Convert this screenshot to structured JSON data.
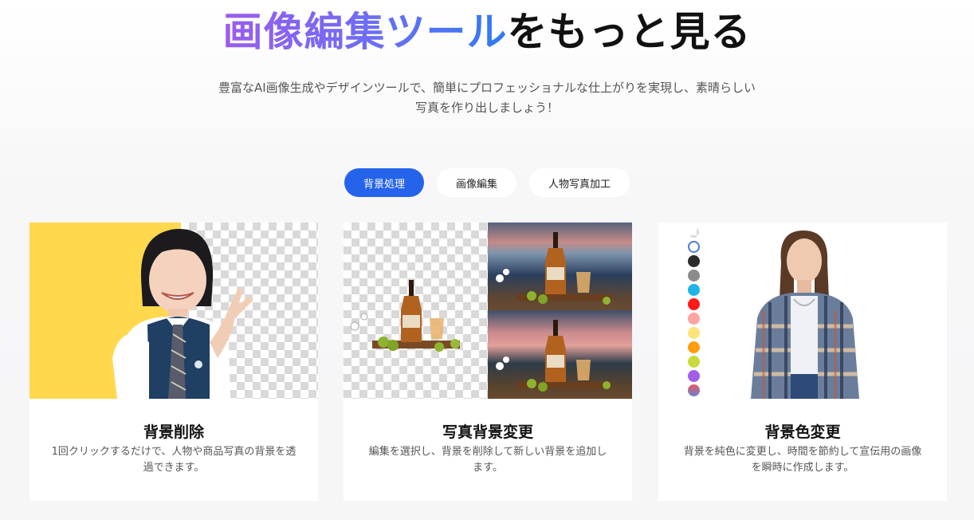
{
  "hero": {
    "title_gradient": "画像編集ツール",
    "title_plain": "をもっと見る",
    "subtitle": "豊富なAI画像生成やデザインツールで、簡単にプロフェッショナルな仕上がりを実現し、素晴らしい写真を作り出しましょう！"
  },
  "tabs": [
    {
      "label": "背景処理",
      "active": true
    },
    {
      "label": "画像編集",
      "active": false
    },
    {
      "label": "人物写真加工",
      "active": false
    }
  ],
  "cards": [
    {
      "title": "背景削除",
      "description": "1回クリックするだけで、人物や商品写真の背景を透過できます。"
    },
    {
      "title": "写真背景変更",
      "description": "編集を選択し、背景を削除して新しい背景を追加します。"
    },
    {
      "title": "背景色変更",
      "description": "背景を純色に変更し、時間を節約して宣伝用の画像を瞬時に作成します。"
    }
  ],
  "colors": {
    "accent": "#2563eb",
    "card_bg_yellow": "#ffd84d",
    "swatches": [
      "transparent",
      "#ffffff",
      "#2b2b2b",
      "#8c8c8c",
      "#1fb5ea",
      "#ff1a1a",
      "#ffa3a3",
      "#ffe27a",
      "#ff9e0f",
      "#c7d93b",
      "#a35ee8",
      "#6a7fd6"
    ]
  }
}
